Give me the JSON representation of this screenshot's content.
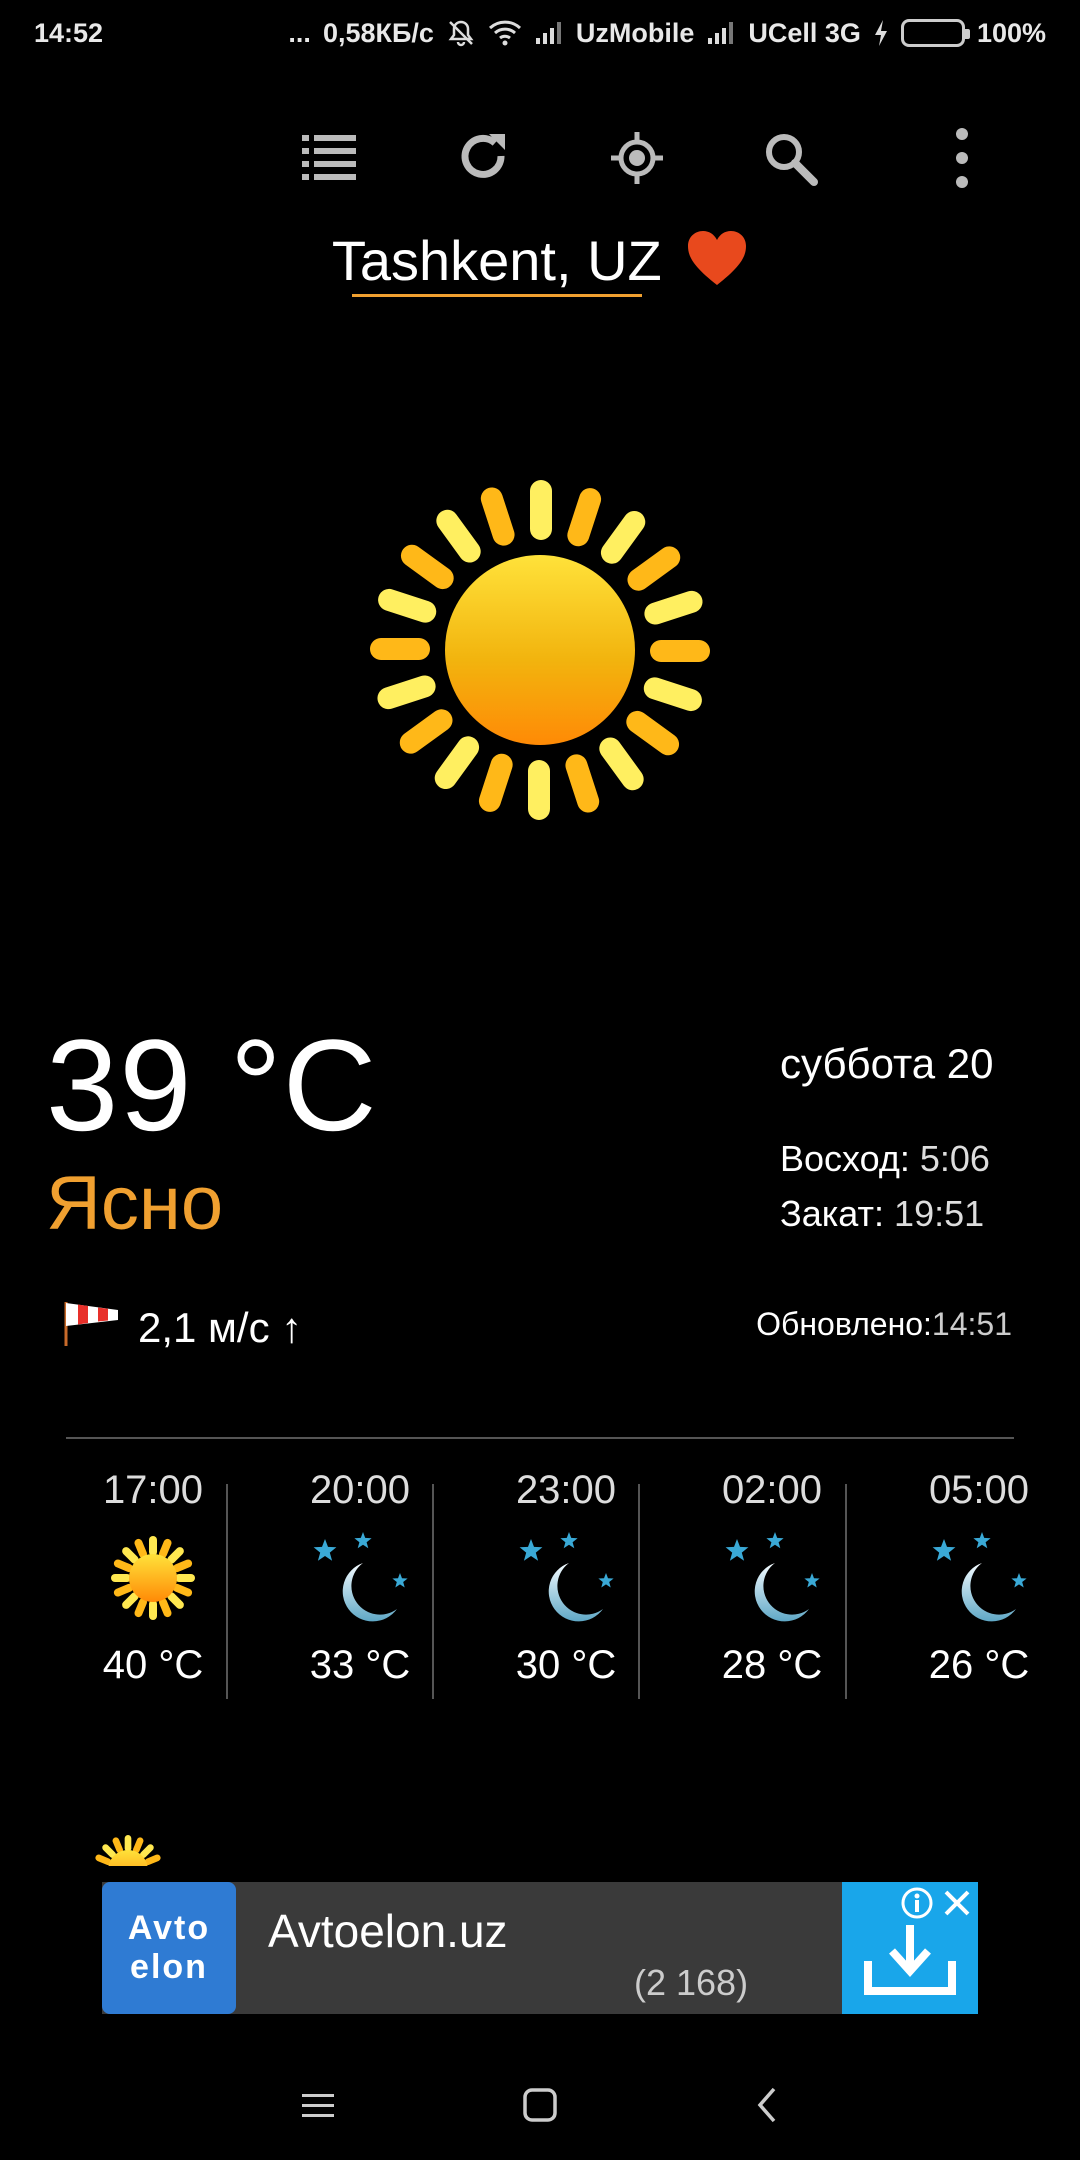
{
  "status_bar": {
    "time": "14:52",
    "dots": "...",
    "speed": "0,58КБ/с",
    "carrier1": "UzMobile",
    "carrier2": "UCell 3G",
    "battery": "100%",
    "battery_level": 1.0
  },
  "toolbar": {
    "icons": [
      "list-icon",
      "refresh-icon",
      "location-target-icon",
      "search-icon",
      "more-vert-icon"
    ]
  },
  "location": {
    "city": "Tashkent, UZ",
    "favorite_icon": "heart-icon",
    "favorite_color": "#e8491d"
  },
  "current": {
    "icon": "sun-icon",
    "temperature": "39 °C",
    "condition": "Ясно",
    "condition_color": "#f0a030",
    "day": "суббота 20",
    "sunrise_label": "Восход:",
    "sunrise": "5:06",
    "sunset_label": "Закат:",
    "sunset": "19:51",
    "wind": "2,1 м/с ↑",
    "wind_icon": "windsock-icon",
    "updated_label": "Обновлено:",
    "updated": "14:51"
  },
  "forecast": [
    {
      "time": "17:00",
      "icon": "sun-icon",
      "temp": "40 °C"
    },
    {
      "time": "20:00",
      "icon": "moon-stars-icon",
      "temp": "33 °C"
    },
    {
      "time": "23:00",
      "icon": "moon-stars-icon",
      "temp": "30 °C"
    },
    {
      "time": "02:00",
      "icon": "moon-stars-icon",
      "temp": "28 °C"
    },
    {
      "time": "05:00",
      "icon": "moon-stars-icon",
      "temp": "26 °C"
    }
  ],
  "ad": {
    "logo_line1": "Avto",
    "logo_line2": "elon",
    "title": "Avtoelon.uz",
    "count": "(2 168)",
    "action_icon": "download-icon",
    "info_icon": "info-icon",
    "close_icon": "close-icon"
  },
  "nav": {
    "icons": [
      "menu-icon",
      "home-icon",
      "back-icon"
    ]
  }
}
